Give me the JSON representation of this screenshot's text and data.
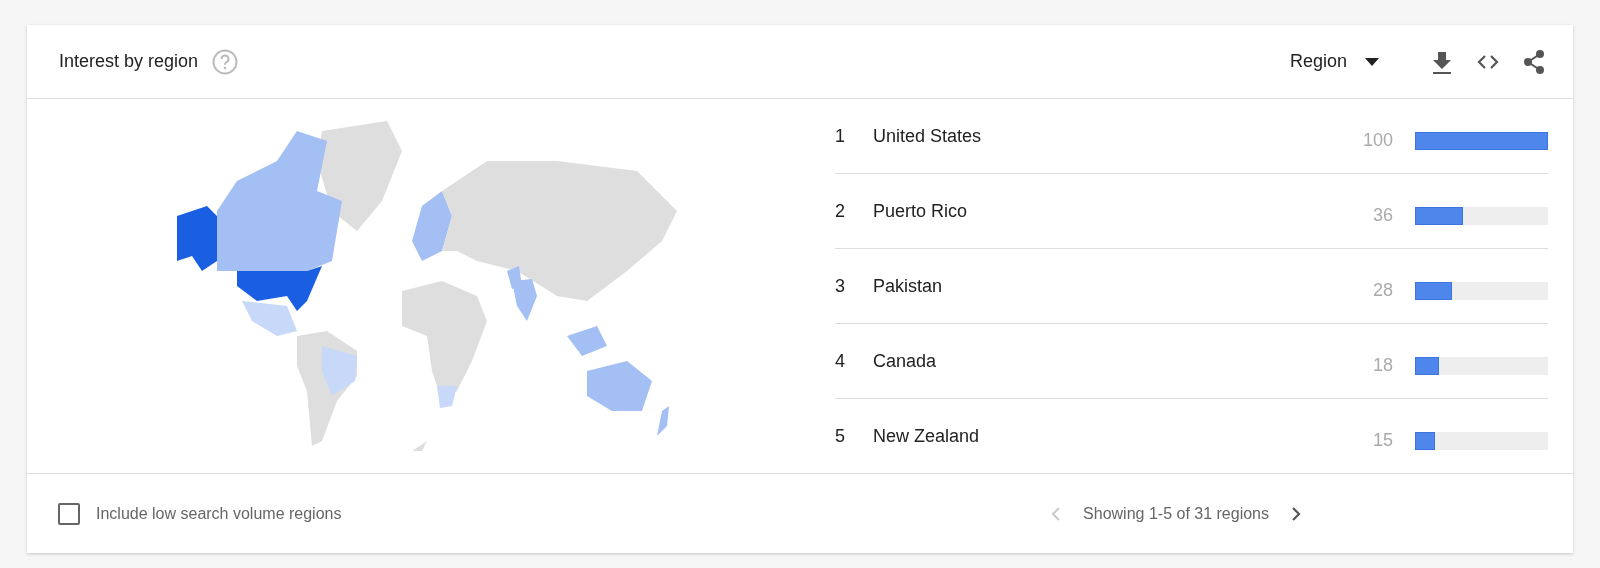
{
  "card": {
    "title": "Interest by region"
  },
  "resolution": {
    "label": "Region"
  },
  "regions": [
    {
      "rank": "1",
      "name": "United States",
      "value": "100",
      "level": 1.0
    },
    {
      "rank": "2",
      "name": "Puerto Rico",
      "value": "36",
      "level": 0.36
    },
    {
      "rank": "3",
      "name": "Pakistan",
      "value": "28",
      "level": 0.28
    },
    {
      "rank": "4",
      "name": "Canada",
      "value": "18",
      "level": 0.18
    },
    {
      "rank": "5",
      "name": "New Zealand",
      "value": "15",
      "level": 0.15
    }
  ],
  "low_volume": {
    "label": "Include low search volume regions",
    "checked": false
  },
  "pagination": {
    "text": "Showing 1-5 of 31 regions",
    "prev_disabled": true,
    "next_disabled": false
  }
}
